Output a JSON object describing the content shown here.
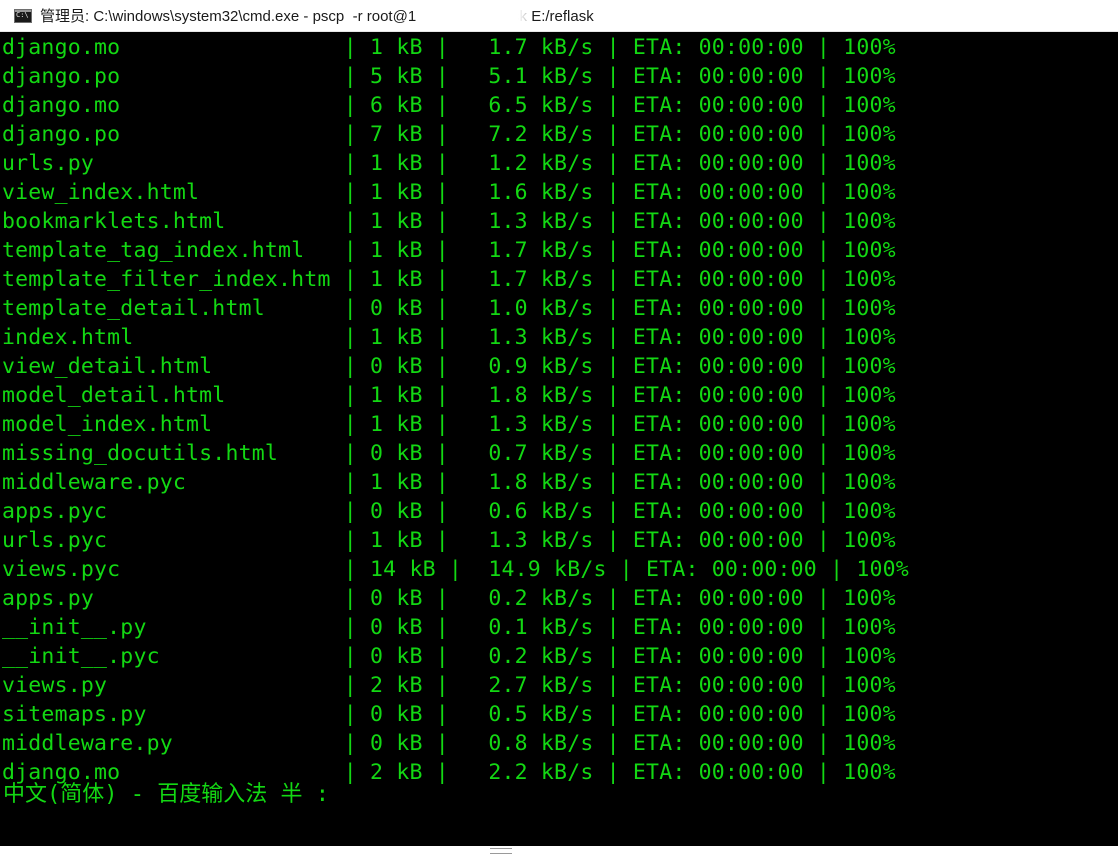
{
  "window": {
    "title": "管理员: C:\\windows\\system32\\cmd.exe - pscp  -r root@1            root/flask E:/reflask",
    "icon": "console-app-icon"
  },
  "colors": {
    "terminal_bg": "#000000",
    "terminal_fg": "#13d813",
    "titlebar_bg": "#ffffff"
  },
  "terminal": {
    "lines": [
      "django.mo                 | 1 kB |   1.7 kB/s | ETA: 00:00:00 | 100%",
      "django.po                 | 5 kB |   5.1 kB/s | ETA: 00:00:00 | 100%",
      "django.mo                 | 6 kB |   6.5 kB/s | ETA: 00:00:00 | 100%",
      "django.po                 | 7 kB |   7.2 kB/s | ETA: 00:00:00 | 100%",
      "urls.py                   | 1 kB |   1.2 kB/s | ETA: 00:00:00 | 100%",
      "view_index.html           | 1 kB |   1.6 kB/s | ETA: 00:00:00 | 100%",
      "bookmarklets.html         | 1 kB |   1.3 kB/s | ETA: 00:00:00 | 100%",
      "template_tag_index.html   | 1 kB |   1.7 kB/s | ETA: 00:00:00 | 100%",
      "template_filter_index.htm | 1 kB |   1.7 kB/s | ETA: 00:00:00 | 100%",
      "template_detail.html      | 0 kB |   1.0 kB/s | ETA: 00:00:00 | 100%",
      "index.html                | 1 kB |   1.3 kB/s | ETA: 00:00:00 | 100%",
      "view_detail.html          | 0 kB |   0.9 kB/s | ETA: 00:00:00 | 100%",
      "model_detail.html         | 1 kB |   1.8 kB/s | ETA: 00:00:00 | 100%",
      "model_index.html          | 1 kB |   1.3 kB/s | ETA: 00:00:00 | 100%",
      "missing_docutils.html     | 0 kB |   0.7 kB/s | ETA: 00:00:00 | 100%",
      "middleware.pyc            | 1 kB |   1.8 kB/s | ETA: 00:00:00 | 100%",
      "apps.pyc                  | 0 kB |   0.6 kB/s | ETA: 00:00:00 | 100%",
      "urls.pyc                  | 1 kB |   1.3 kB/s | ETA: 00:00:00 | 100%",
      "views.pyc                 | 14 kB |  14.9 kB/s | ETA: 00:00:00 | 100%",
      "apps.py                   | 0 kB |   0.2 kB/s | ETA: 00:00:00 | 100%",
      "__init__.py               | 0 kB |   0.1 kB/s | ETA: 00:00:00 | 100%",
      "__init__.pyc              | 0 kB |   0.2 kB/s | ETA: 00:00:00 | 100%",
      "views.py                  | 2 kB |   2.7 kB/s | ETA: 00:00:00 | 100%",
      "sitemaps.py               | 0 kB |   0.5 kB/s | ETA: 00:00:00 | 100%",
      "middleware.py             | 0 kB |   0.8 kB/s | ETA: 00:00:00 | 100%",
      "django.mo                 | 2 kB |   2.2 kB/s | ETA: 00:00:00 | 100%"
    ],
    "ime_status": "中文(简体) - 百度输入法 半 :"
  }
}
